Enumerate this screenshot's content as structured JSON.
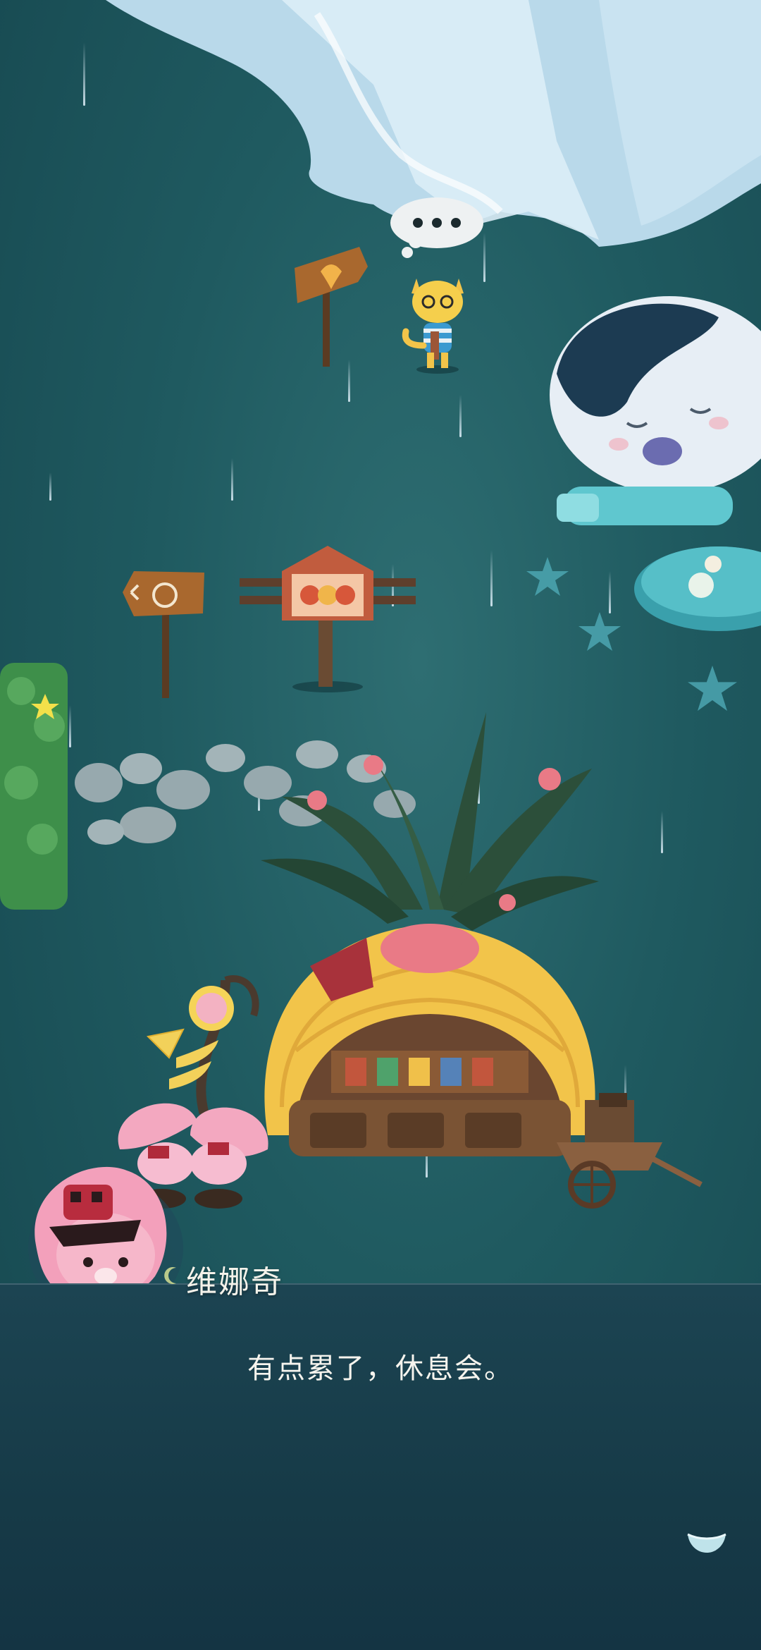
{
  "dialogue": {
    "speaker": "维娜奇",
    "text": "有点累了，休息会。"
  },
  "thought_bubble": {
    "text": "..."
  },
  "icons": {
    "speaker_badge": "crescent-moon-icon",
    "advance": "chevron-down-icon"
  },
  "colors": {
    "background": "#1f5a60",
    "dialogue_panel": "#163a47",
    "text": "#f6f4ee"
  }
}
